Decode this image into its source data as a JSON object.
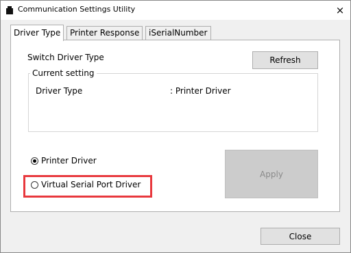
{
  "window": {
    "title": "Communication Settings Utility",
    "close_glyph": "×"
  },
  "tabs": [
    {
      "label": "Driver Type",
      "active": true
    },
    {
      "label": "Printer Response",
      "active": false
    },
    {
      "label": "iSerialNumber",
      "active": false
    }
  ],
  "panel": {
    "switch_label": "Switch Driver Type",
    "refresh_label": "Refresh",
    "current_setting": {
      "group_title": "Current setting",
      "field_label": "Driver Type",
      "field_value": ": Printer Driver"
    },
    "options": [
      {
        "label": "Printer Driver",
        "selected": true
      },
      {
        "label": "Virtual Serial Port Driver",
        "selected": false
      }
    ],
    "apply_label": "Apply",
    "apply_enabled": false
  },
  "footer": {
    "close_label": "Close"
  },
  "colors": {
    "highlight": "#e8383d",
    "dialog_bg": "#f0f0f0",
    "panel_bg": "#ffffff"
  },
  "icons": {
    "app": "printer-app-icon",
    "close": "close-icon"
  }
}
